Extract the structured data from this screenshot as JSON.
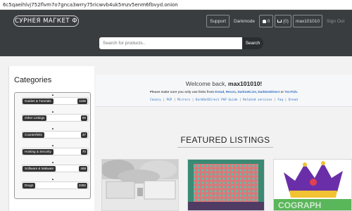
{
  "browser": {
    "url": "6c5qaeihlvj752flvm7o7gnca3wrry75ricwvb4uk5mzv5enm6fbvyd.onion"
  },
  "nav": {
    "brand": "СУРНЕЯ МАГКЕТ Ф",
    "support": "Support",
    "darkmode": "Darkmode",
    "notifications_count": "0",
    "cart_count": "(0)",
    "username": "max101010",
    "signout": "Sign Out"
  },
  "search": {
    "placeholder": "Search for products..",
    "button": "Search"
  },
  "sidebar": {
    "title": "Categories",
    "categories": [
      {
        "label": "Guides & Tutorials",
        "count": "1156"
      },
      {
        "label": "Other Listings",
        "count": "69"
      },
      {
        "label": "Counterfeits",
        "count": "37"
      },
      {
        "label": "Hosting & Security",
        "count": "70"
      },
      {
        "label": "Software & Malware",
        "count": "498"
      },
      {
        "label": "Drugs",
        "count": "2092"
      }
    ]
  },
  "welcome": {
    "greeting": "Welcome back, ",
    "username": "max101010!",
    "note_prefix": "Please make sure you only use links from ",
    "note_links": [
      "Dread",
      "Recon",
      "DarknetLive",
      "DarkDotDirect",
      "Tor.Fish"
    ],
    "links": [
      "Canary",
      "PGP",
      "Mirrors",
      "DarkDotDirect PGP Guide",
      "Related services",
      "Faq",
      "Dread"
    ]
  },
  "featured": {
    "title": "FEATURED LISTINGS",
    "watermark": "COGRAPH"
  },
  "colors": {
    "header_bg": "#3a3d40",
    "link": "#2b6fc2",
    "badge_bg": "#333333"
  }
}
